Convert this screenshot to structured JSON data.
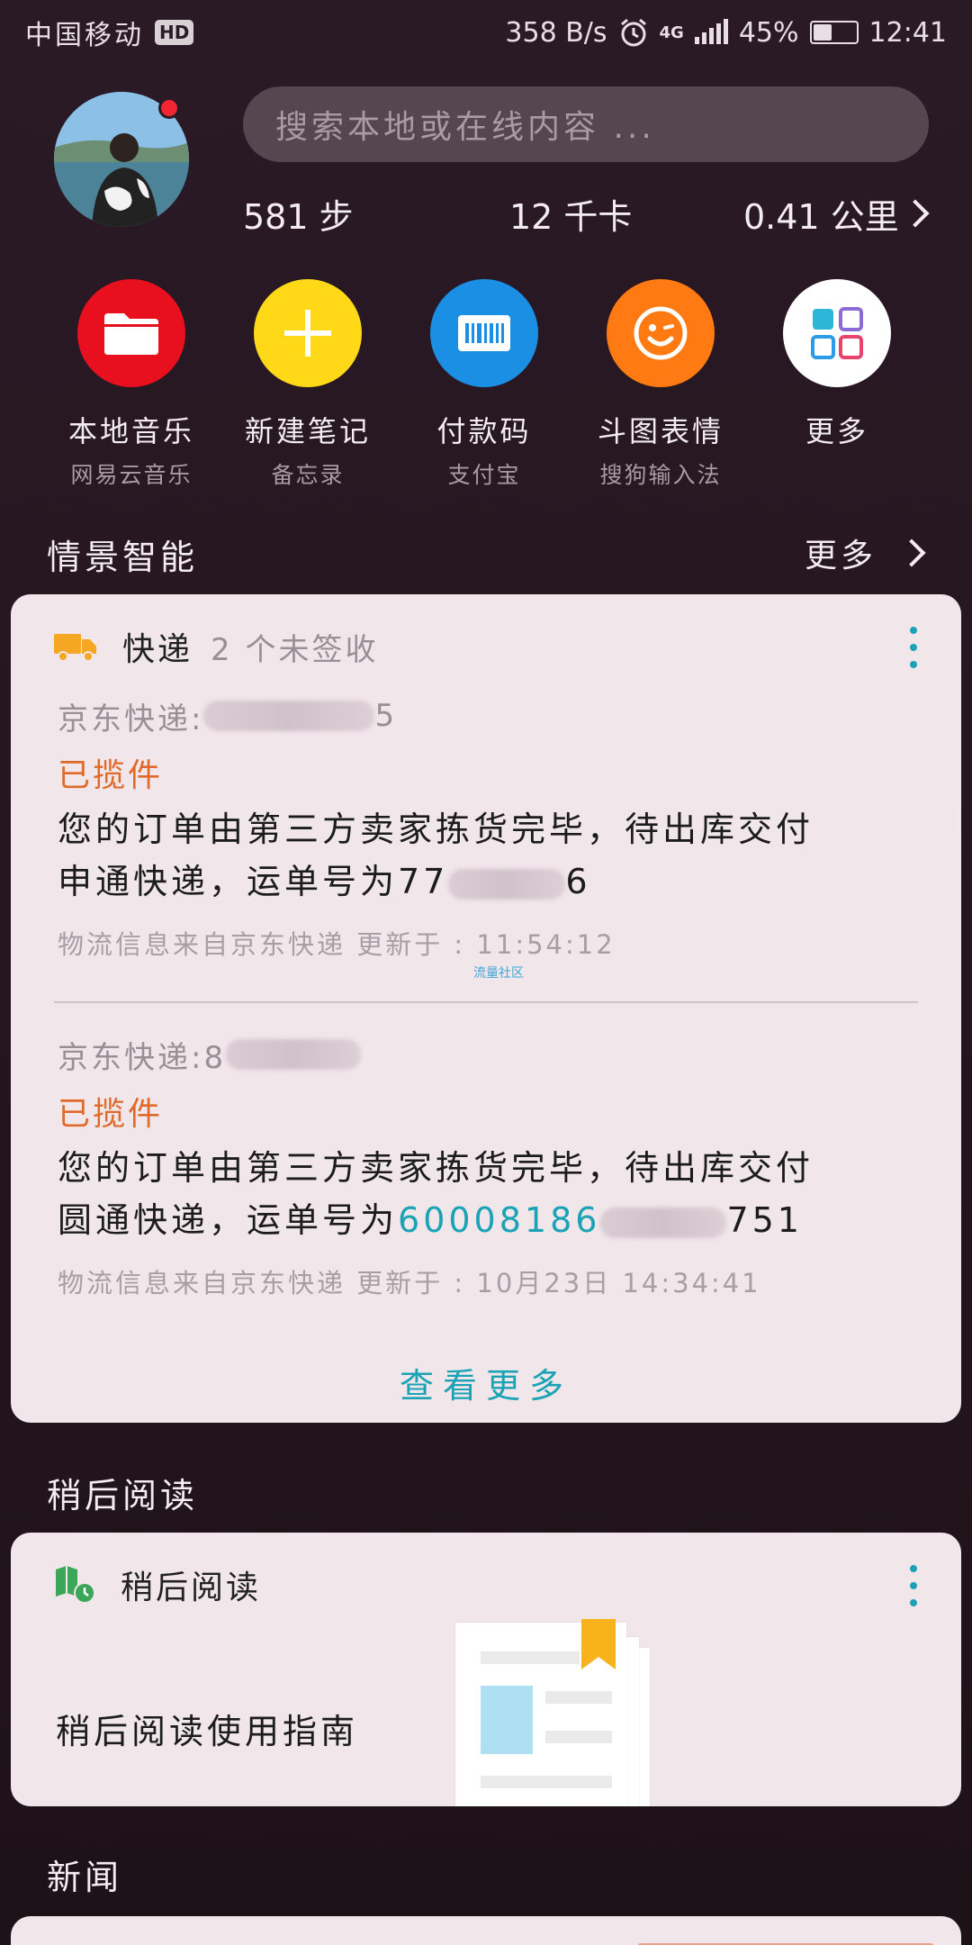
{
  "status_bar": {
    "carrier": "中国移动",
    "hd": "HD",
    "speed": "358 B/s",
    "network": "4G",
    "battery": "45%",
    "battery_level": 0.45,
    "time": "12:41"
  },
  "header": {
    "search_placeholder": "搜索本地或在线内容 ...",
    "steps": "581 步",
    "calories": "12 千卡",
    "distance": "0.41 公里"
  },
  "apps": [
    {
      "name": "本地音乐",
      "sub": "网易云音乐",
      "color": "#e8101e",
      "icon": "folder-icon"
    },
    {
      "name": "新建笔记",
      "sub": "备忘录",
      "color": "#ffd817",
      "icon": "plus-icon"
    },
    {
      "name": "付款码",
      "sub": "支付宝",
      "color": "#1a8fe3",
      "icon": "barcode-icon"
    },
    {
      "name": "斗图表情",
      "sub": "搜狗输入法",
      "color": "#ff7a12",
      "icon": "smiley-icon"
    },
    {
      "name": "更多",
      "sub": "",
      "color": "#ffffff",
      "icon": "grid-icon"
    }
  ],
  "scene": {
    "title": "情景智能",
    "more": "更多"
  },
  "express_card": {
    "title": "快递",
    "subtitle": "2 个未签收",
    "entries": [
      {
        "carrier_prefix": "京东快递:",
        "carrier_suffix": "5",
        "status": "已揽件",
        "desc_line1": "您的订单由第三方卖家拣货完毕，待出库交付",
        "desc_line2_prefix": "申通快递，运单号为77",
        "desc_line2_suffix": "6",
        "meta": "物流信息来自京东快递 更新于 : 11:54:12"
      },
      {
        "carrier_prefix": "京东快递:8",
        "carrier_suffix": "",
        "status": "已揽件",
        "desc_line1": "您的订单由第三方卖家拣货完毕，待出库交付",
        "desc_line2_prefix": "圆通快递，运单号为",
        "desc_line2_teal": "600081",
        "desc_line2_teal2": "86",
        "desc_line2_suffix": "751",
        "meta": "物流信息来自京东快递 更新于 : 10月23日 14:34:41"
      }
    ],
    "watermark": "流量社区",
    "view_more": "查看更多"
  },
  "read_later": {
    "section_title": "稍后阅读",
    "card_title": "稍后阅读",
    "guide": "稍后阅读使用指南"
  },
  "news": {
    "section_title": "新闻"
  }
}
